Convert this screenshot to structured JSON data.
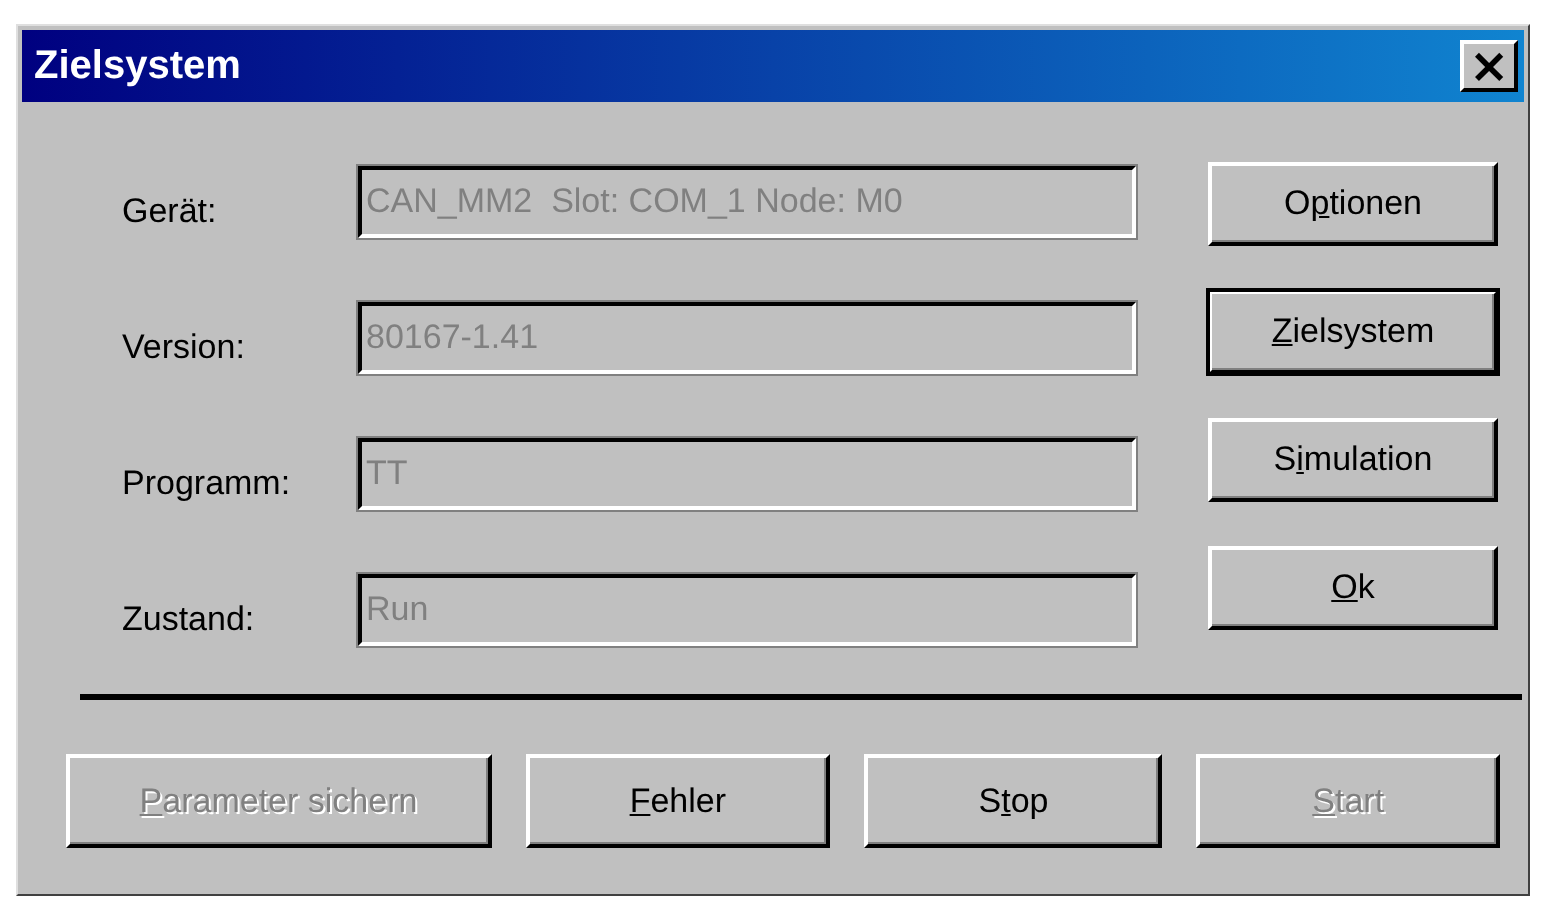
{
  "window": {
    "title": "Zielsystem",
    "close": "×"
  },
  "fields": [
    {
      "label": "Gerät:",
      "value": "CAN_MM2  Slot: COM_1 Node: M0",
      "disabled": true
    },
    {
      "label": "Version:",
      "value": "80167-1.41",
      "disabled": true
    },
    {
      "label": "Programm:",
      "value": "TT",
      "disabled": true
    },
    {
      "label": "Zustand:",
      "value": "Run",
      "disabled": true
    }
  ],
  "side_buttons": [
    {
      "pre": "O",
      "key": "p",
      "post": "tionen",
      "disabled": false,
      "default": false
    },
    {
      "key": "Z",
      "post": "ielsystem",
      "disabled": false,
      "default": true
    },
    {
      "pre": "S",
      "key": "i",
      "post": "mulation",
      "disabled": false,
      "default": false
    },
    {
      "key": "O",
      "post": "k",
      "disabled": false,
      "default": false
    }
  ],
  "bottom_buttons": [
    {
      "key": "P",
      "post": "arameter sichern",
      "disabled": true,
      "default": false
    },
    {
      "key": "F",
      "post": "ehler",
      "disabled": false,
      "default": false
    },
    {
      "pre": "S",
      "key": "t",
      "post": "op",
      "disabled": false,
      "default": false
    },
    {
      "key": "S",
      "post": "tart",
      "disabled": true,
      "default": false
    }
  ]
}
